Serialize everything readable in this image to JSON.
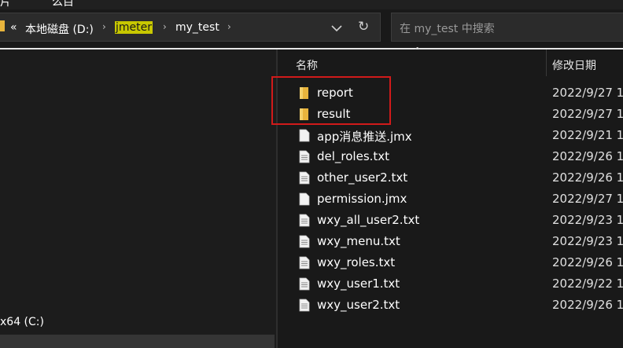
{
  "window": {
    "top_fragments": [
      "片",
      "么目"
    ]
  },
  "address_bar": {
    "overflow": "«",
    "crumbs": [
      "本地磁盘 (D:)",
      "jmeter",
      "my_test"
    ],
    "separator": "›",
    "dropdown_icon": "chevron-down-icon",
    "refresh_icon": "refresh-icon",
    "refresh_glyph": "↻"
  },
  "search": {
    "placeholder": "在 my_test 中搜索"
  },
  "nav_pane": {
    "drive_label": "x64 (C:)"
  },
  "columns": {
    "name": "名称",
    "date_modified": "修改日期",
    "sort_indicator": "^"
  },
  "files": [
    {
      "name": "report",
      "type": "folder",
      "date": "2022/9/27 1"
    },
    {
      "name": "result",
      "type": "folder",
      "date": "2022/9/27 1"
    },
    {
      "name": "app消息推送.jmx",
      "type": "file",
      "date": "2022/9/21 1"
    },
    {
      "name": "del_roles.txt",
      "type": "text",
      "date": "2022/9/26 1"
    },
    {
      "name": "other_user2.txt",
      "type": "text",
      "date": "2022/9/26 1"
    },
    {
      "name": "permission.jmx",
      "type": "file",
      "date": "2022/9/27 1"
    },
    {
      "name": "wxy_all_user2.txt",
      "type": "text",
      "date": "2022/9/23 1"
    },
    {
      "name": "wxy_menu.txt",
      "type": "text",
      "date": "2022/9/23 1"
    },
    {
      "name": "wxy_roles.txt",
      "type": "text",
      "date": "2022/9/26 1"
    },
    {
      "name": "wxy_user1.txt",
      "type": "text",
      "date": "2022/9/22 1"
    },
    {
      "name": "wxy_user2.txt",
      "type": "text",
      "date": "2022/9/26 1"
    }
  ],
  "colors": {
    "highlight_box": "#d11a1a",
    "breadcrumb_highlight": "#c8c800",
    "folder": "#e8b43c"
  }
}
